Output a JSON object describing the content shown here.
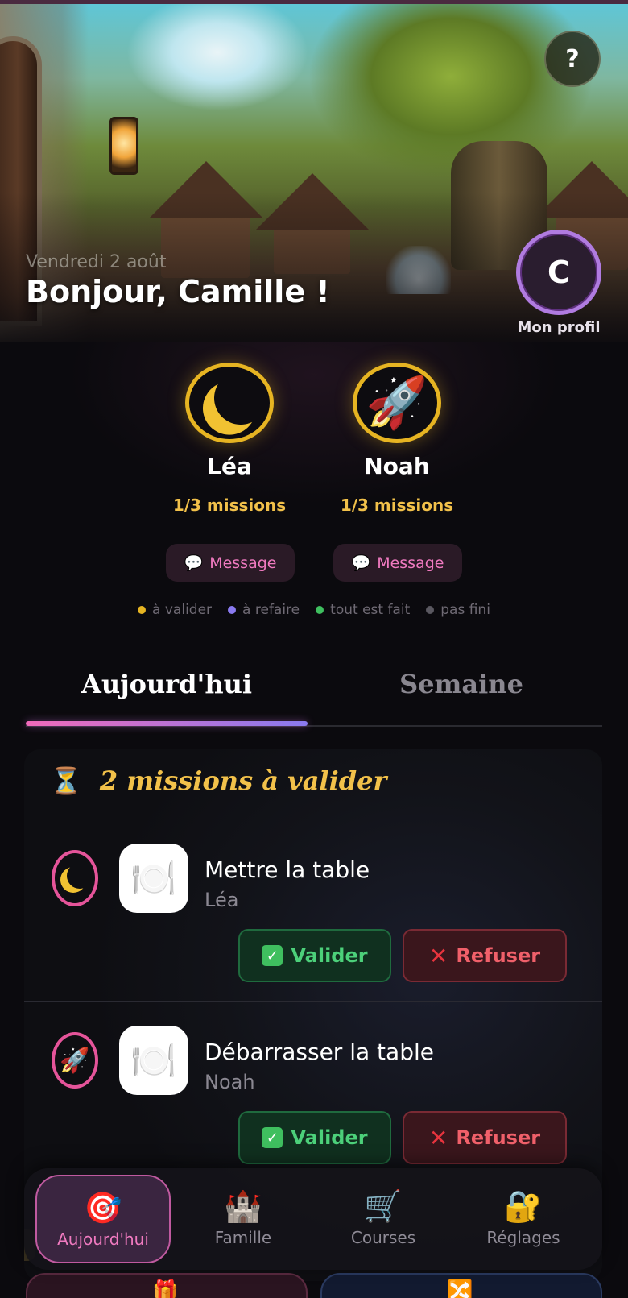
{
  "header": {
    "date": "Vendredi 2 août",
    "greeting": "Bonjour, Camille !",
    "help_label": "?",
    "profile_initial": "C",
    "profile_label": "Mon profil"
  },
  "kids": [
    {
      "name": "Léa",
      "avatar": "moon-icon",
      "progress": "1/3 missions",
      "message_label": "Message"
    },
    {
      "name": "Noah",
      "avatar": "rocket-icon",
      "progress": "1/3 missions",
      "message_label": "Message"
    }
  ],
  "legend": [
    {
      "label": "à valider",
      "color": "#e6b422"
    },
    {
      "label": "à refaire",
      "color": "#8a7af0"
    },
    {
      "label": "tout est fait",
      "color": "#3fbf5f"
    },
    {
      "label": "pas fini",
      "color": "#5a5860"
    }
  ],
  "tabs": {
    "today": "Aujourd'hui",
    "week": "Semaine",
    "active": "today"
  },
  "pending": {
    "title": "2 missions à valider",
    "items": [
      {
        "task": "Mettre la table",
        "kid": "Léa",
        "kid_icon": "moon-icon",
        "task_icon": "plate-icon",
        "validate": "Valider",
        "refuse": "Refuser"
      },
      {
        "task": "Débarrasser la table",
        "kid": "Noah",
        "kid_icon": "rocket-icon",
        "task_icon": "dishes-icon",
        "validate": "Valider",
        "refuse": "Refuser"
      }
    ]
  },
  "nav": [
    {
      "label": "Aujourd'hui",
      "icon": "target-icon",
      "active": true
    },
    {
      "label": "Famille",
      "icon": "castle-icon",
      "active": false
    },
    {
      "label": "Courses",
      "icon": "cart-icon",
      "active": false
    },
    {
      "label": "Réglages",
      "icon": "lock-icon",
      "active": false
    }
  ],
  "colors": {
    "accent_pink": "#f06aba",
    "accent_gold": "#f2c14a",
    "validate_green": "#4cd07a",
    "refuse_red": "#f0606a"
  }
}
